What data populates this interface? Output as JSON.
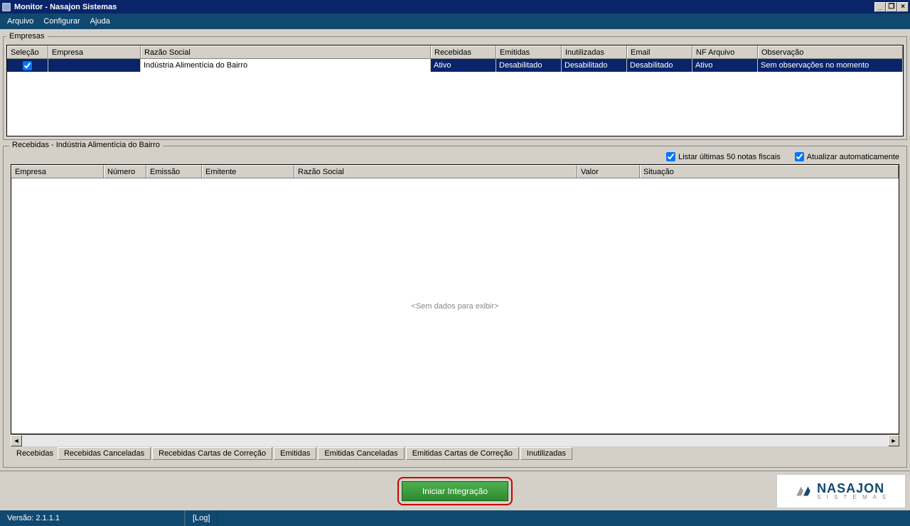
{
  "window": {
    "title": "Monitor - Nasajon Sistemas"
  },
  "menu": {
    "arquivo": "Arquivo",
    "configurar": "Configurar",
    "ajuda": "Ajuda"
  },
  "empresas": {
    "legend": "Empresas",
    "headers": {
      "selecao": "Seleção",
      "empresa": "Empresa",
      "razao": "Razão Social",
      "recebidas": "Recebidas",
      "emitidas": "Emitidas",
      "inutilizadas": "Inutilizadas",
      "email": "Email",
      "nfarquivo": "NF Arquivo",
      "obs": "Observação"
    },
    "row": {
      "empresa": "",
      "razao": "Indústria Alimentícia do Bairro",
      "recebidas": "Ativo",
      "emitidas": "Desabilitado",
      "inutilizadas": "Desabilitado",
      "email": "Desabilitado",
      "nfarquivo": "Ativo",
      "obs": "Sem observações no momento"
    }
  },
  "detail": {
    "legend": "Recebidas - Indústria Alimentícia do Bairro",
    "opt_listar": "Listar últimas 50 notas fiscais",
    "opt_atualizar": "Atualizar automaticamente",
    "headers": {
      "empresa": "Empresa",
      "numero": "Número",
      "emissao": "Emissão",
      "emitente": "Emitente",
      "razao": "Razão Social",
      "valor": "Valor",
      "situacao": "Situação"
    },
    "empty": "<Sem dados para exibir>"
  },
  "tabs": {
    "t0": "Recebidas",
    "t1": "Recebidas Canceladas",
    "t2": "Recebidas Cartas de Correção",
    "t3": "Emitidas",
    "t4": "Emitidas Canceladas",
    "t5": "Emitidas Cartas de Correção",
    "t6": "Inutilizadas"
  },
  "footer": {
    "start": "Iniciar Integração",
    "brand": "NASAJON",
    "brand_sub": "S I S T E M A S"
  },
  "status": {
    "version": "Versão: 2.1.1.1",
    "log": "[Log]"
  }
}
